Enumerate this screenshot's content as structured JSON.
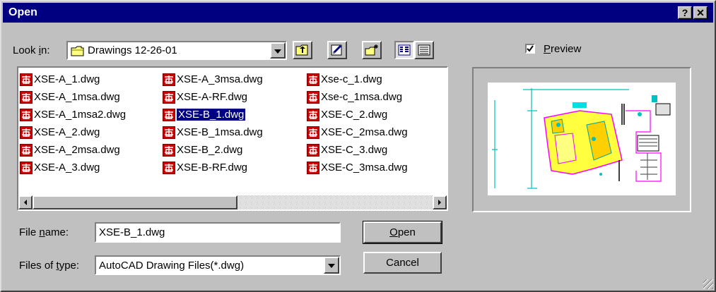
{
  "window": {
    "title": "Open"
  },
  "title_buttons": {
    "help": "?",
    "close": "✕"
  },
  "look_in": {
    "label_prefix": "Look ",
    "label_underlined": "i",
    "label_suffix": "n:",
    "value": "Drawings 12-26-01"
  },
  "toolbar": [
    "up-one-level",
    "find",
    "create-new-folder",
    "list-view",
    "details-view"
  ],
  "preview": {
    "label": "Preview",
    "underlined": "P",
    "checked": true
  },
  "files": {
    "columns": [
      [
        "XSE-A_1.dwg",
        "XSE-A_1msa.dwg",
        "XSE-A_1msa2.dwg",
        "XSE-A_2.dwg",
        "XSE-A_2msa.dwg",
        "XSE-A_3.dwg"
      ],
      [
        "XSE-A_3msa.dwg",
        "XSE-A-RF.dwg",
        "XSE-B_1.dwg",
        "XSE-B_1msa.dwg",
        "XSE-B_2.dwg",
        "XSE-B-RF.dwg"
      ],
      [
        "Xse-c_1.dwg",
        "Xse-c_1msa.dwg",
        "XSE-C_2.dwg",
        "XSE-C_2msa.dwg",
        "XSE-C_3.dwg",
        "XSE-C_3msa.dwg"
      ]
    ],
    "selected": "XSE-B_1.dwg"
  },
  "file_name": {
    "label_prefix": "File ",
    "label_underlined": "n",
    "label_suffix": "ame:",
    "value": "XSE-B_1.dwg"
  },
  "file_type": {
    "label_prefix": "Files of ",
    "label_underlined": "t",
    "label_suffix": "ype:",
    "value": "AutoCAD Drawing Files(*.dwg)"
  },
  "buttons": {
    "open": "Open",
    "open_underlined": "O",
    "cancel": "Cancel"
  },
  "colors": {
    "titlebar": "#000080",
    "face": "#c0c0c0",
    "selection": "#000080",
    "dwg_icon": "#cc0000"
  }
}
